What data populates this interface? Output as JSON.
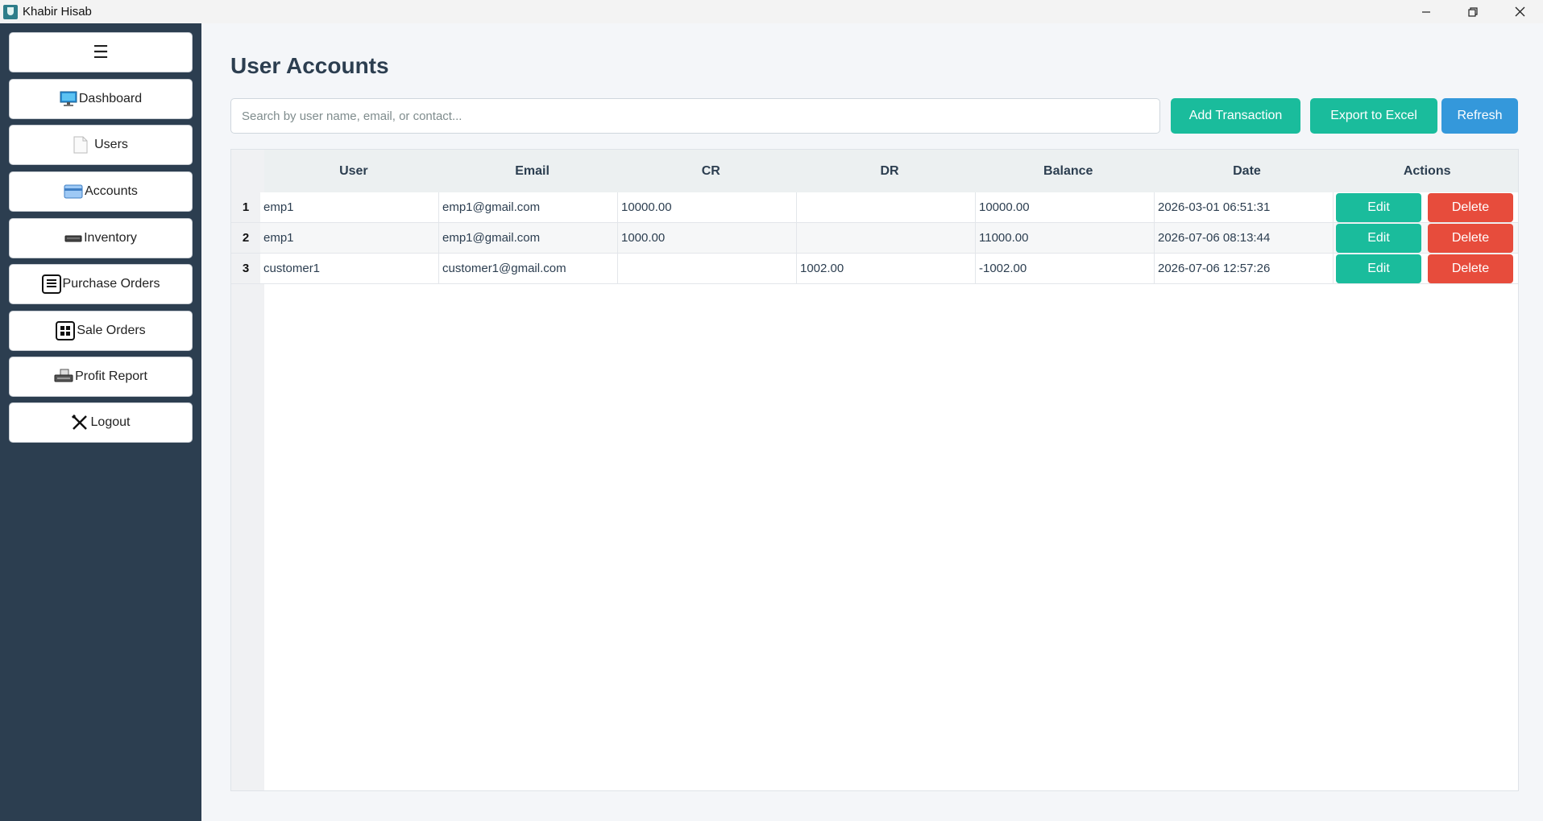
{
  "window": {
    "title": "Khabir Hisab"
  },
  "sidebar": {
    "menu_icon": "☰",
    "items": [
      {
        "label": "Dashboard",
        "icon": "monitor-icon"
      },
      {
        "label": "Users",
        "icon": "document-icon"
      },
      {
        "label": "Accounts",
        "icon": "credit-card-icon"
      },
      {
        "label": "Inventory",
        "icon": "keyboard-icon"
      },
      {
        "label": "Purchase Orders",
        "icon": "list-icon"
      },
      {
        "label": "Sale Orders",
        "icon": "grid-icon"
      },
      {
        "label": "Profit Report",
        "icon": "printer-icon"
      },
      {
        "label": "Logout",
        "icon": "cross-tools-icon"
      }
    ]
  },
  "main": {
    "title": "User Accounts",
    "search": {
      "placeholder": "Search by user name, email, or contact...",
      "value": ""
    },
    "buttons": {
      "add_transaction": "Add Transaction",
      "export": "Export to Excel",
      "refresh": "Refresh"
    }
  },
  "table": {
    "columns": [
      "User",
      "Email",
      "CR",
      "DR",
      "Balance",
      "Date",
      "Actions"
    ],
    "rows": [
      {
        "num": "1",
        "user": "emp1",
        "email": "emp1@gmail.com",
        "cr": "10000.00",
        "dr": "",
        "balance": "10000.00",
        "date": "2026-03-01 06:51:31",
        "edit": "Edit",
        "delete": "Delete"
      },
      {
        "num": "2",
        "user": "emp1",
        "email": "emp1@gmail.com",
        "cr": "1000.00",
        "dr": "",
        "balance": "11000.00",
        "date": "2026-07-06 08:13:44",
        "edit": "Edit",
        "delete": "Delete"
      },
      {
        "num": "3",
        "user": "customer1",
        "email": "customer1@gmail.com",
        "cr": "",
        "dr": "1002.00",
        "balance": "-1002.00",
        "date": "2026-07-06 12:57:26",
        "edit": "Edit",
        "delete": "Delete"
      }
    ]
  },
  "colors": {
    "sidebar_bg": "#2c3e50",
    "primary_green": "#1abc9c",
    "refresh_blue": "#3498db",
    "delete_red": "#e74c3c"
  }
}
